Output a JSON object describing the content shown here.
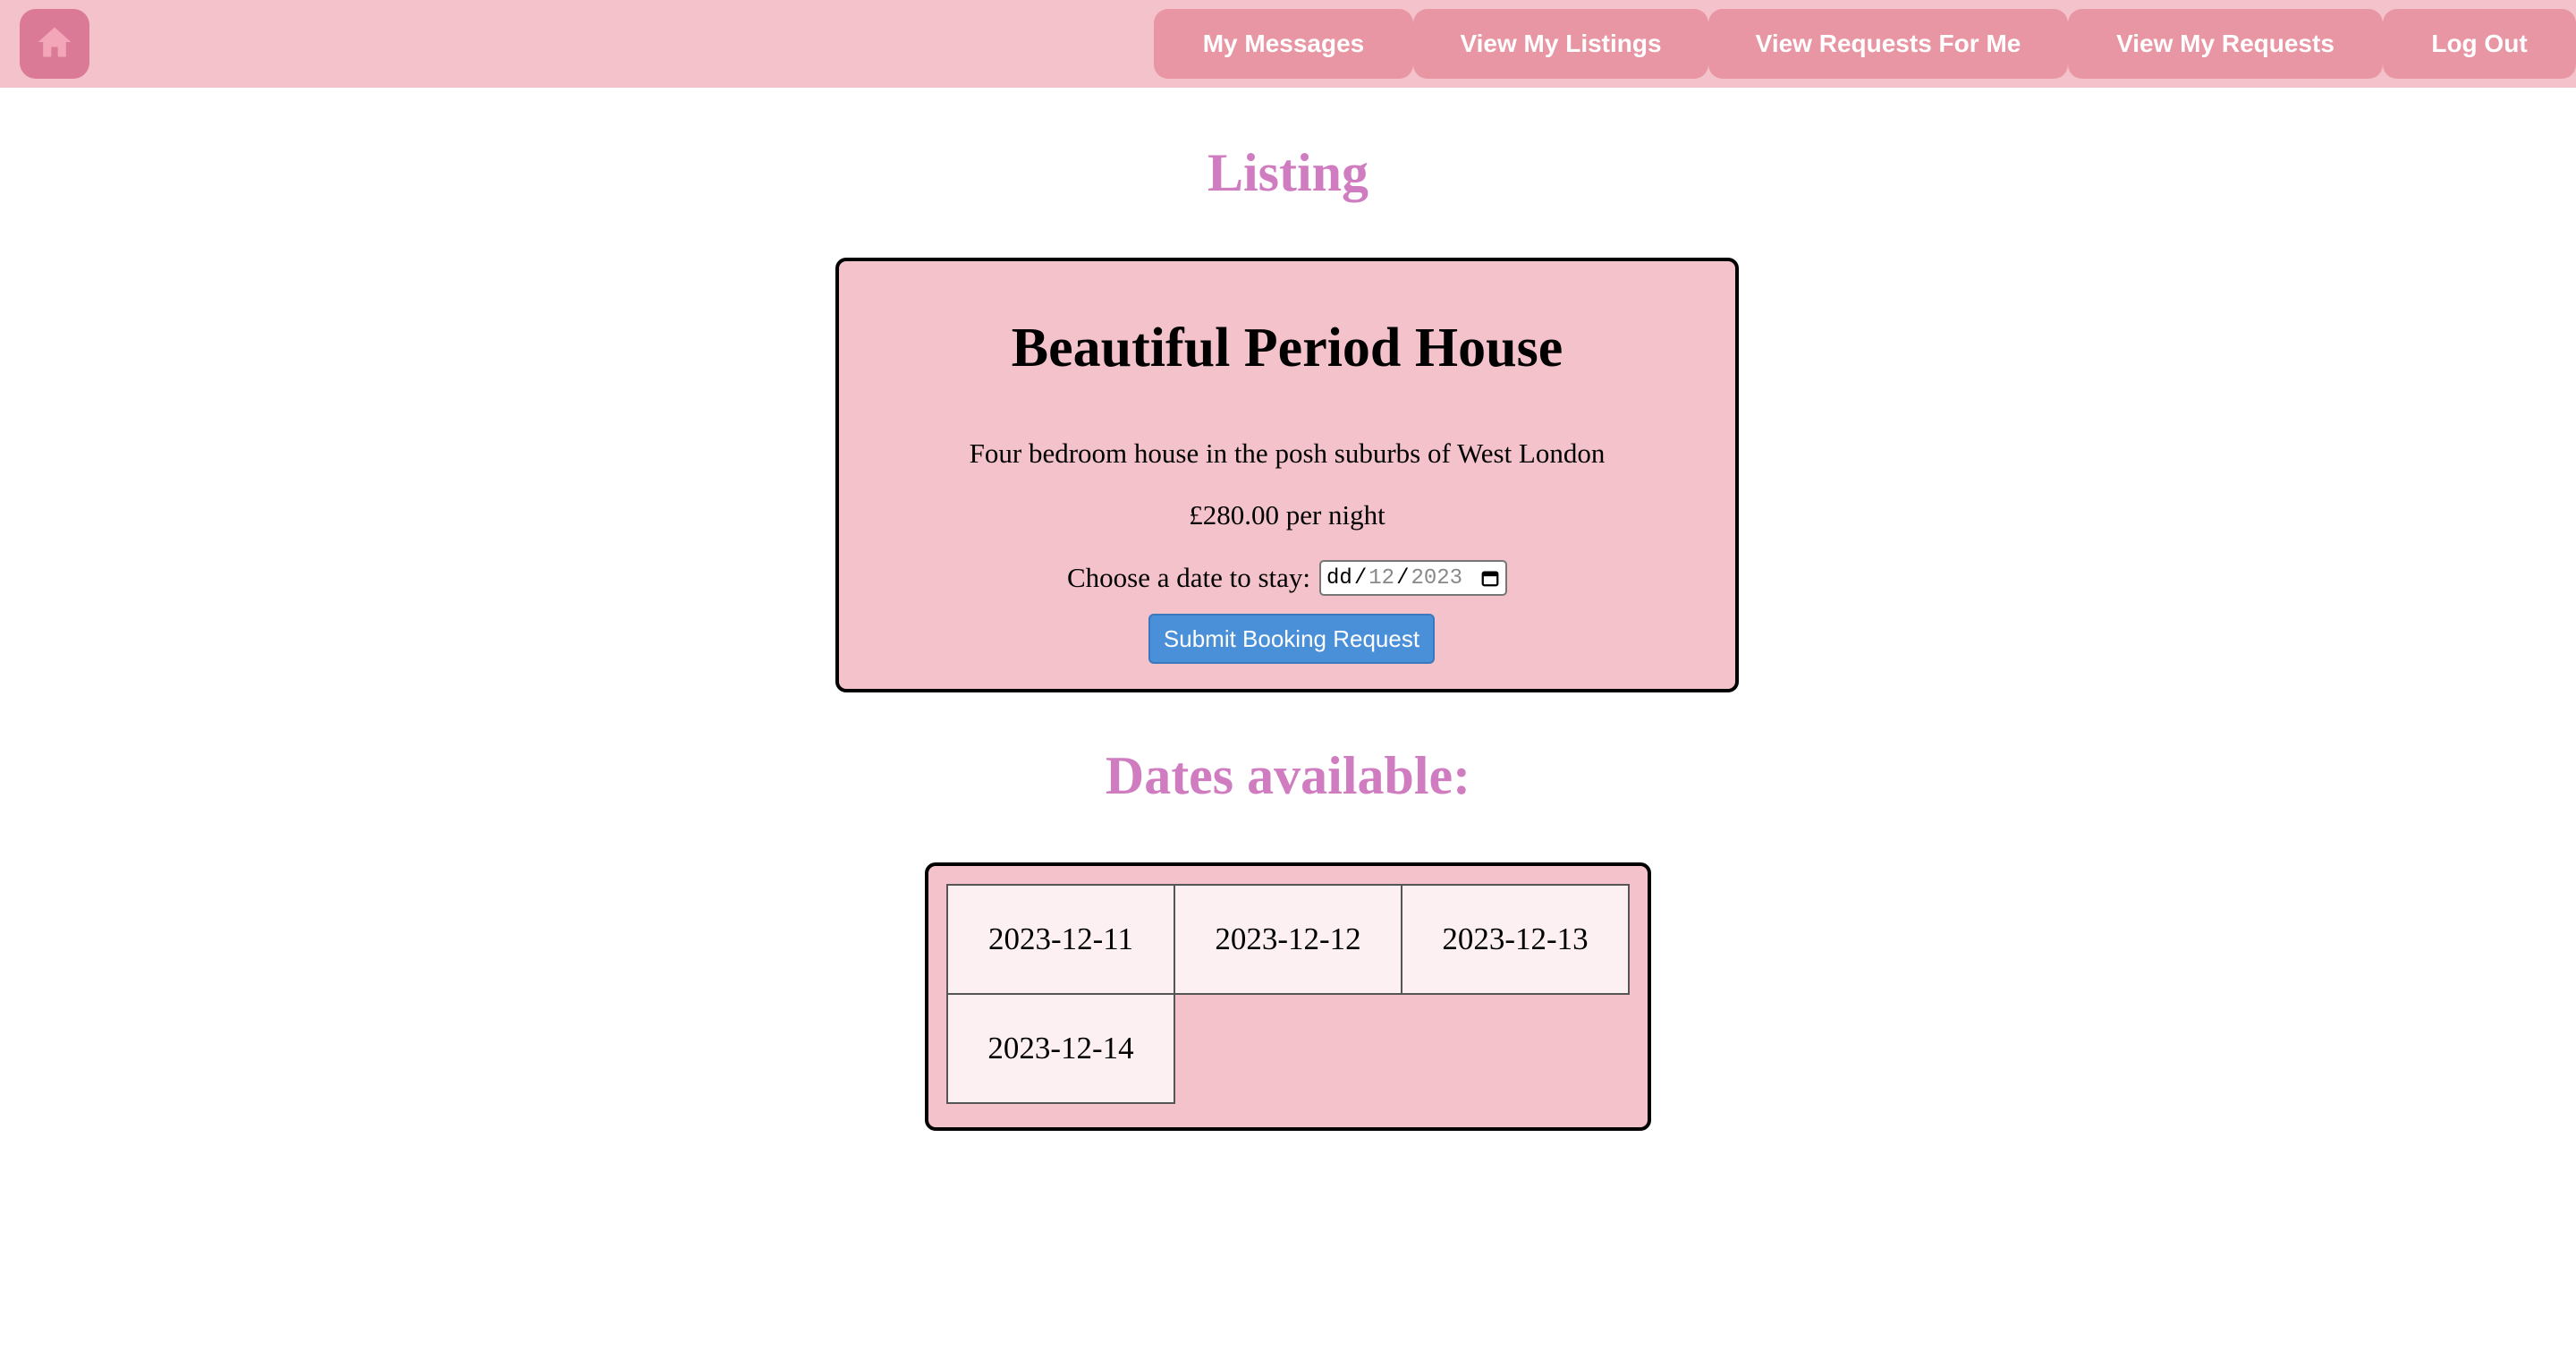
{
  "nav": {
    "home_icon": "home-icon",
    "items": [
      {
        "label": "My Messages"
      },
      {
        "label": "View My Listings"
      },
      {
        "label": "View Requests For Me"
      },
      {
        "label": "View My Requests"
      },
      {
        "label": "Log Out"
      }
    ]
  },
  "page": {
    "heading": "Listing",
    "dates_heading": "Dates available:"
  },
  "listing": {
    "title": "Beautiful Period House",
    "description": "Four bedroom house in the posh suburbs of West London",
    "price": "£280.00 per night",
    "date_label": "Choose a date to stay:",
    "date_input": {
      "dd": "dd",
      "mm": "12",
      "yyyy": "2023",
      "sep": "/"
    },
    "submit_label": "Submit Booking Request"
  },
  "available_dates": [
    "2023-12-11",
    "2023-12-12",
    "2023-12-13",
    "2023-12-14"
  ],
  "colors": {
    "navbar": "#f4c2cb",
    "nav_button": "#e896a4",
    "home_button": "#db7a96",
    "heading": "#d07cc0",
    "card": "#f4c2cb",
    "submit_button": "#4a90d9",
    "date_cell": "#fcf0f2"
  }
}
